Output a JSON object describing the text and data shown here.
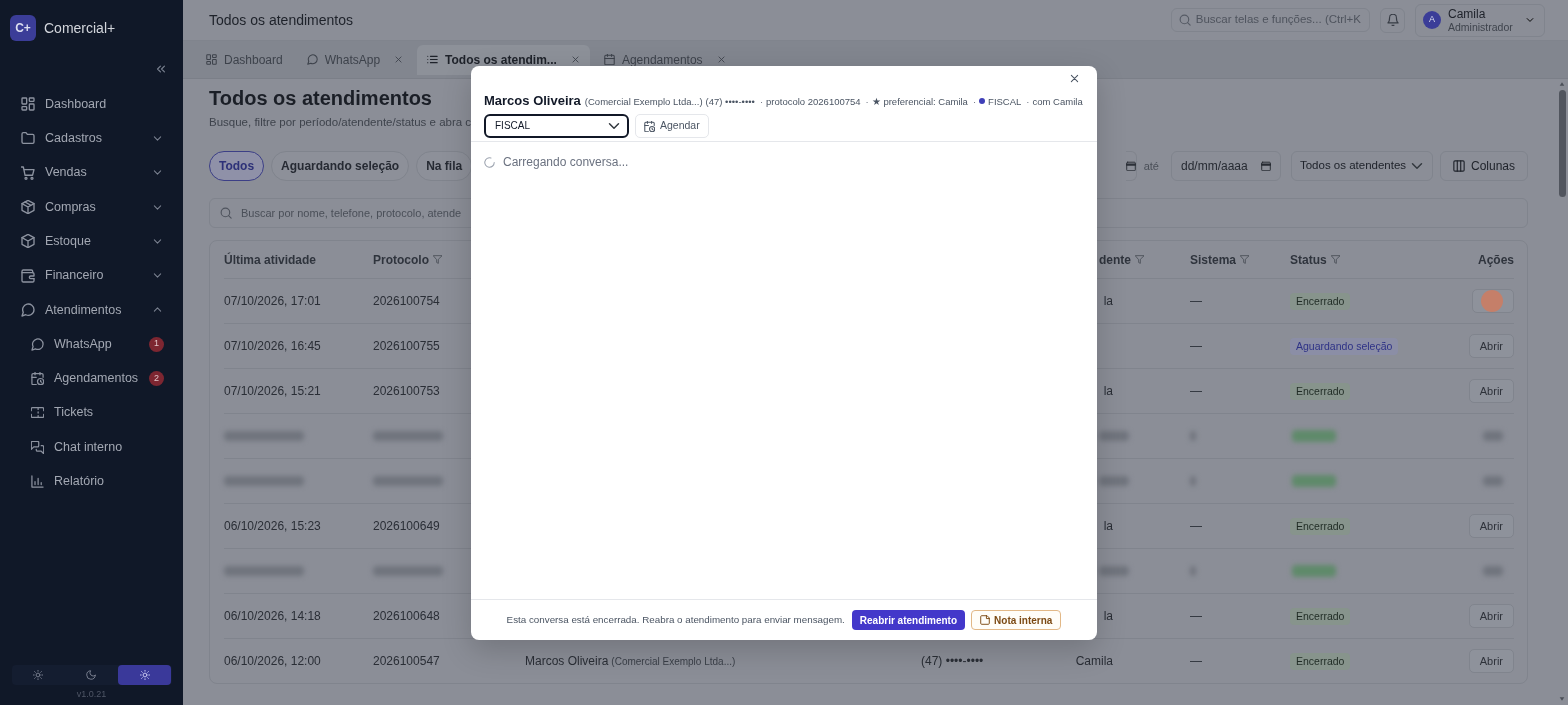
{
  "sidebar": {
    "logo": "C+",
    "brand": "Comercial+",
    "items": [
      {
        "label": "Dashboard"
      },
      {
        "label": "Cadastros",
        "expanded": false
      },
      {
        "label": "Vendas",
        "expanded": false
      },
      {
        "label": "Compras",
        "expanded": false
      },
      {
        "label": "Estoque",
        "expanded": false
      },
      {
        "label": "Financeiro",
        "expanded": false
      },
      {
        "label": "Atendimentos",
        "expanded": true,
        "children": [
          {
            "label": "WhatsApp",
            "badge": "1"
          },
          {
            "label": "Agendamentos",
            "badge": "2"
          },
          {
            "label": "Tickets"
          },
          {
            "label": "Chat interno"
          },
          {
            "label": "Relatório"
          }
        ]
      }
    ],
    "theme_modes": [
      {
        "selected": false
      },
      {
        "selected": false
      },
      {
        "selected": true
      }
    ],
    "version": "v1.0.21"
  },
  "header": {
    "title": "Todos os atendimentos",
    "search": {
      "placeholder": "Buscar telas e funções... (Ctrl+K"
    },
    "user": {
      "initial": "A",
      "name": "Camila",
      "role": "Administrador"
    }
  },
  "tabs": [
    {
      "label": "Dashboard",
      "closable": false,
      "selected": false
    },
    {
      "label": "WhatsApp",
      "closable": true,
      "selected": false
    },
    {
      "label": "Todos os atendim...",
      "closable": true,
      "selected": true
    },
    {
      "label": "Agendamentos",
      "closable": true,
      "selected": false
    }
  ],
  "page": {
    "title": "Todos os atendimentos",
    "subtitle": "Busque, filtre por período/atendente/status e abra c",
    "filters": [
      {
        "label": "Todos",
        "selected": true
      },
      {
        "label": "Aguardando seleção",
        "selected": false
      },
      {
        "label": "Na fila",
        "selected": false
      }
    ],
    "date_separator": "até",
    "date_to": {
      "placeholder": "dd/mm/aaaa"
    },
    "attendant_select": {
      "value": "Todos os atendentes"
    },
    "columns_button": "Colunas",
    "search": {
      "placeholder": "Buscar por nome, telefone, protocolo, atende"
    }
  },
  "table": {
    "columns": [
      {
        "label": "Última atividade",
        "filter": false
      },
      {
        "label": "Protocolo",
        "filter": true
      },
      {
        "label": "dente",
        "filter": true
      },
      {
        "label": "Sistema",
        "filter": true
      },
      {
        "label": "Status",
        "filter": true
      },
      {
        "label": "Ações",
        "filter": false
      }
    ],
    "rows": [
      {
        "blurred": false,
        "click_highlight": true,
        "last_activity": "07/10/2026, 17:01",
        "protocol": "2026100754",
        "column_5": "la",
        "system": "—",
        "status": {
          "label": "Encerrado",
          "kind": "closed"
        }
      },
      {
        "blurred": false,
        "click_highlight": false,
        "last_activity": "07/10/2026, 16:45",
        "protocol": "2026100755",
        "system": "—",
        "status": {
          "label": "Aguardando seleção",
          "kind": "waiting"
        },
        "action": "Abrir"
      },
      {
        "blurred": false,
        "click_highlight": false,
        "last_activity": "07/10/2026, 15:21",
        "protocol": "2026100753",
        "column_5": "la",
        "system": "—",
        "status": {
          "label": "Encerrado",
          "kind": "closed"
        },
        "action": "Abrir"
      },
      {
        "blurred": true,
        "click_highlight": false
      },
      {
        "blurred": true,
        "click_highlight": false
      },
      {
        "blurred": false,
        "click_highlight": false,
        "last_activity": "06/10/2026, 15:23",
        "protocol": "2026100649",
        "column_5": "la",
        "system": "—",
        "status": {
          "label": "Encerrado",
          "kind": "closed"
        },
        "action": "Abrir"
      },
      {
        "blurred": true,
        "click_highlight": false
      },
      {
        "blurred": false,
        "click_highlight": false,
        "last_activity": "06/10/2026, 14:18",
        "protocol": "2026100648",
        "column_5": "la",
        "system": "—",
        "status": {
          "label": "Encerrado",
          "kind": "closed"
        },
        "action": "Abrir"
      },
      {
        "blurred": false,
        "click_highlight": false,
        "last_activity": "06/10/2026, 12:00",
        "protocol": "2026100547",
        "column_3": {
          "name": "Marcos Oliveira",
          "detail": "(Comercial Exemplo Ltda...)"
        },
        "column_4": "(47) ••••-••••",
        "column_5": "Camila",
        "system": "—",
        "status": {
          "label": "Encerrado",
          "kind": "closed"
        },
        "action": "Abrir"
      }
    ]
  },
  "modal": {
    "contact": "Marcos Oliveira",
    "company": "(Comercial Exemplo Ltda...)",
    "phone": "(47) ••••-••••",
    "meta": [
      {
        "sep": "·",
        "text": "protocolo 2026100754"
      },
      {
        "sep": "·",
        "text": "★ preferencial: Camila"
      },
      {
        "sep": "·",
        "text": "FISCAL",
        "color": "#3f3fb8"
      },
      {
        "sep": "·",
        "text": "com Camila"
      }
    ],
    "queue": {
      "value": "FISCAL"
    },
    "schedule_button": "Agendar",
    "loading": "Carregando conversa...",
    "notice": "Esta conversa está encerrada. Reabra o atendimento para enviar mensagem.",
    "primary_button": "Reabrir atendimento",
    "note_button": "Nota interna"
  }
}
